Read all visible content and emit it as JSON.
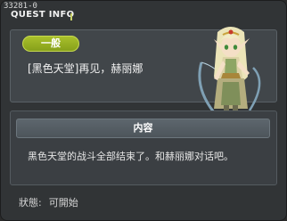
{
  "window": {
    "quest_id": "33281-0",
    "title": "QUEST INFO"
  },
  "quest": {
    "category_badge": "一般",
    "name": "[黑色天堂]再见，赫丽娜",
    "npc_image": "npc-portrait-icon"
  },
  "content": {
    "header": "内容",
    "description": "黑色天堂的战斗全部结束了。和赫丽娜对话吧。"
  },
  "status": {
    "label": "狀態:",
    "value": "可開始"
  },
  "colors": {
    "badge_green": "#9bb326",
    "panel_bg": "#41464a",
    "window_bg": "#313436"
  }
}
